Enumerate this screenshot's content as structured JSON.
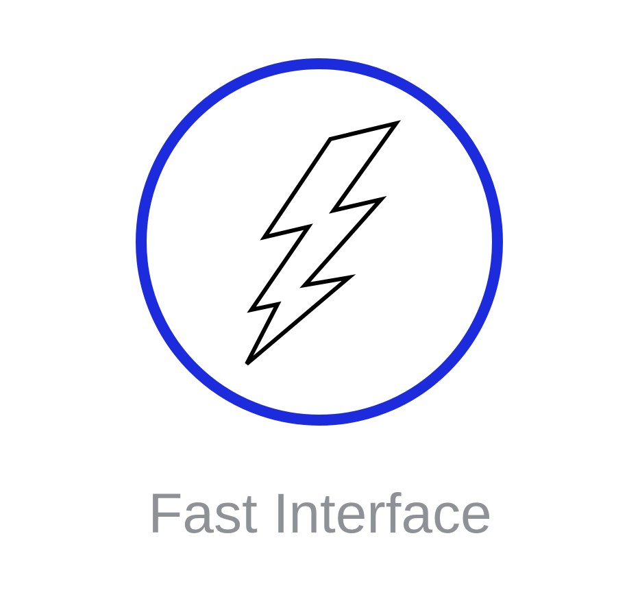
{
  "feature": {
    "icon": "lightning-bolt-icon",
    "ring_icon": "circle-outline-icon",
    "label": "Fast Interface"
  },
  "colors": {
    "ring": "#1c2bdc",
    "bolt_stroke": "#000000",
    "label": "#8e9196",
    "background": "#ffffff"
  }
}
